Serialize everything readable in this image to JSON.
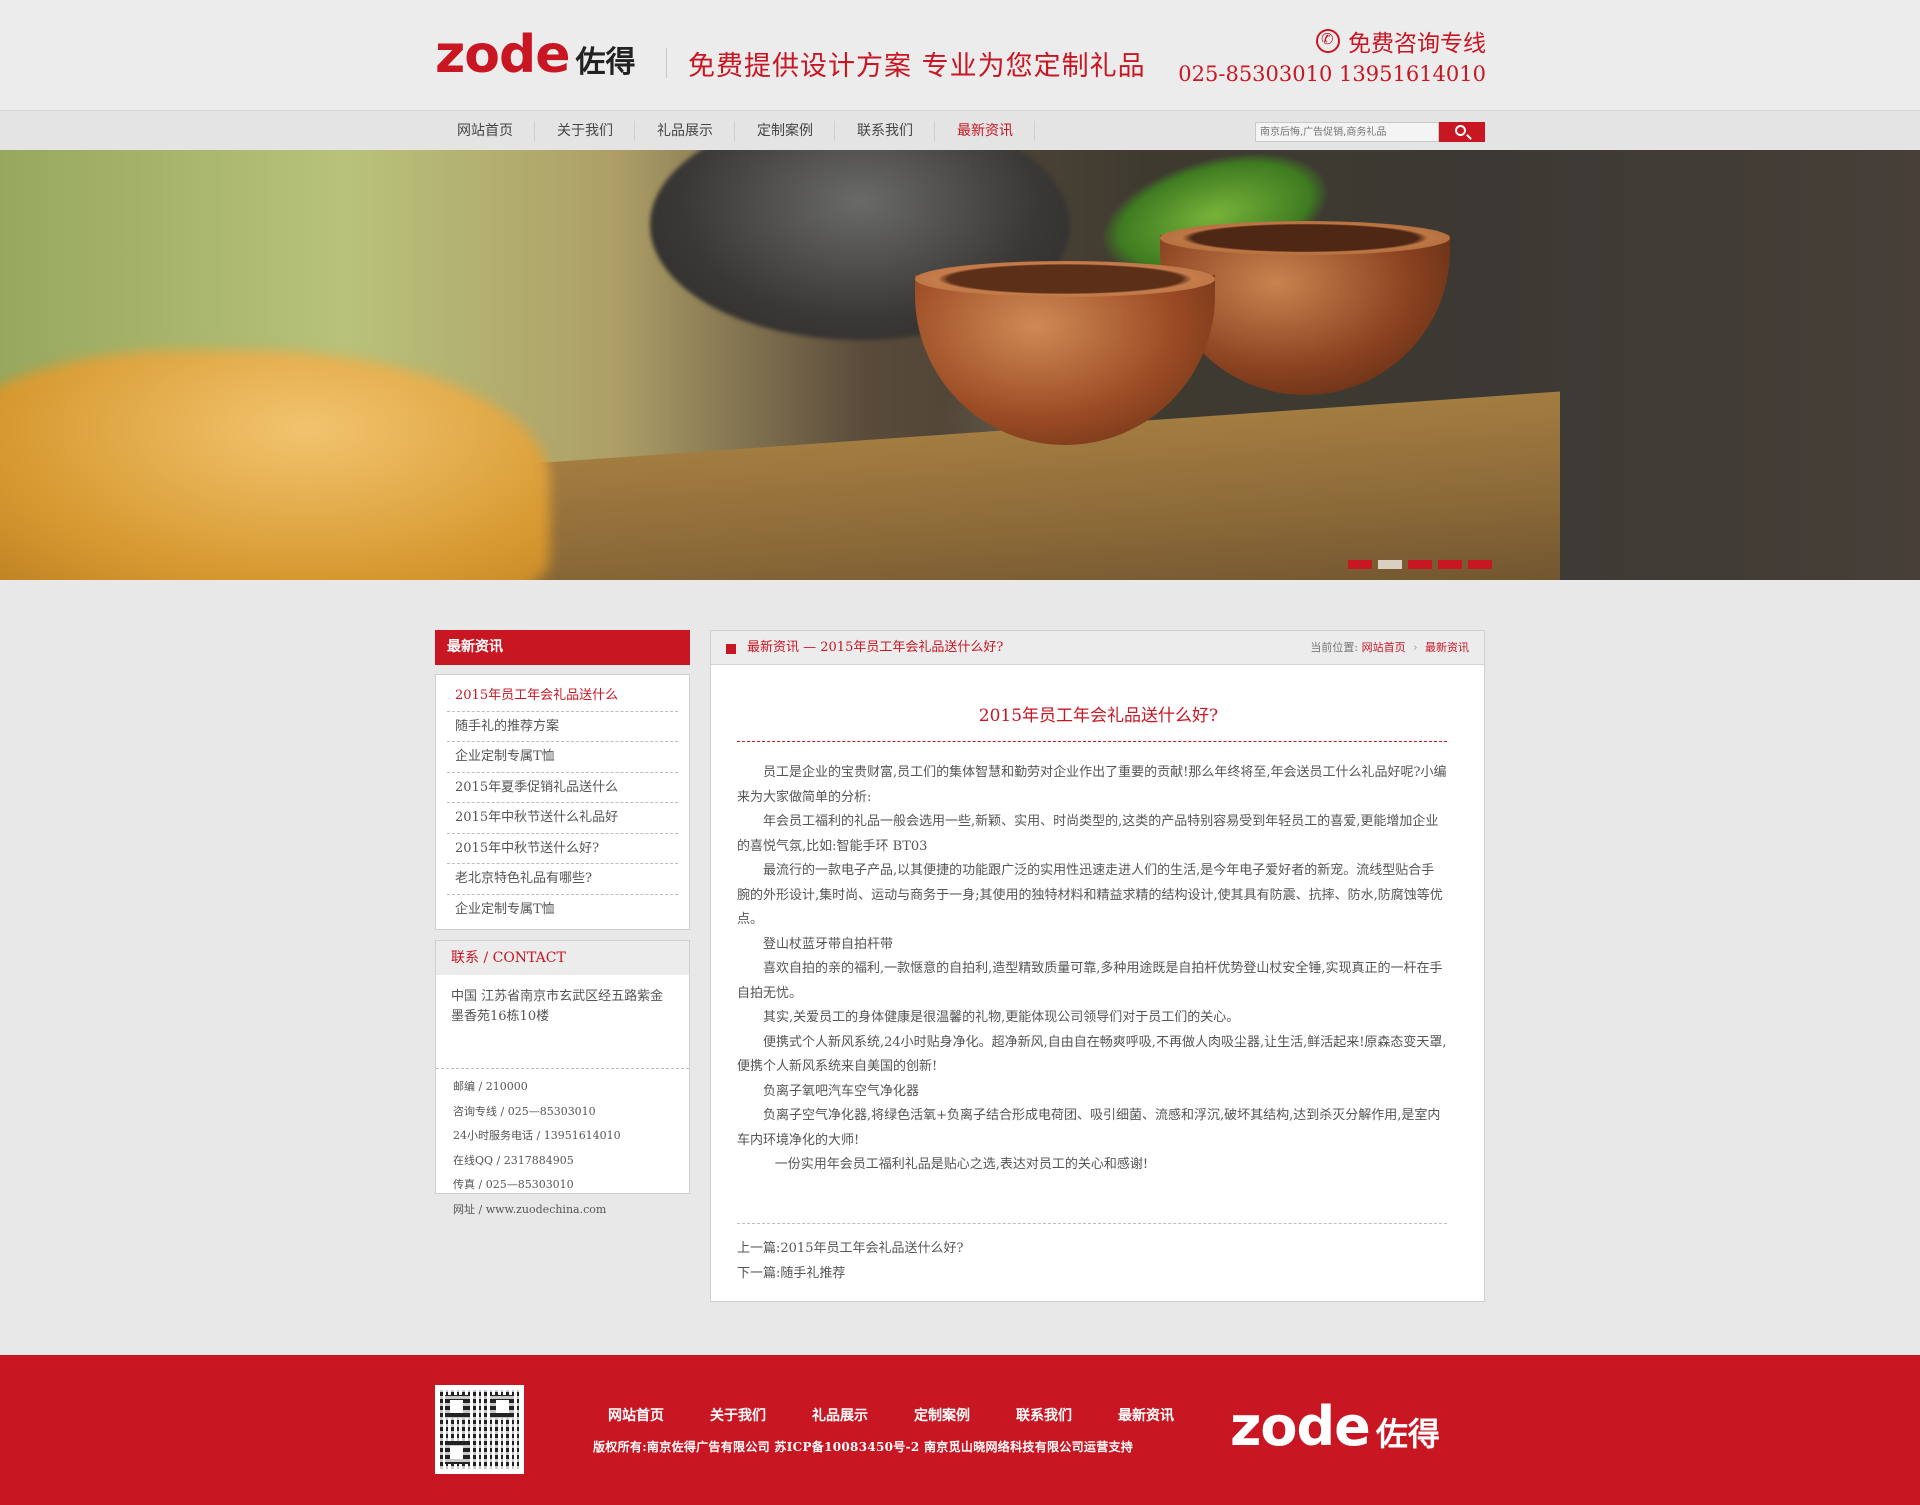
{
  "header": {
    "logo_en": "zode",
    "logo_cn": "佐得",
    "slogan": "免费提供设计方案  专业为您定制礼品",
    "hotline_label": "免费咨询专线",
    "hotline_numbers": "025-85303010  13951614010"
  },
  "nav": {
    "items": [
      {
        "label": "网站首页"
      },
      {
        "label": "关于我们"
      },
      {
        "label": "礼品展示"
      },
      {
        "label": "定制案例"
      },
      {
        "label": "联系我们"
      },
      {
        "label": "最新资讯"
      }
    ],
    "active_index": 5,
    "search_placeholder": "南京后悔,广告促销,商务礼品"
  },
  "banner": {
    "slide_count": 5,
    "active_slide": 1
  },
  "sidebar": {
    "title": "最新资讯",
    "items": [
      {
        "label": "2015年员工年会礼品送什么"
      },
      {
        "label": "随手礼的推荐方案"
      },
      {
        "label": "企业定制专属T恤"
      },
      {
        "label": "2015年夏季促销礼品送什么"
      },
      {
        "label": "2015年中秋节送什么礼品好"
      },
      {
        "label": "2015年中秋节送什么好?"
      },
      {
        "label": "老北京特色礼品有哪些?"
      },
      {
        "label": "企业定制专属T恤"
      }
    ],
    "active_index": 0
  },
  "contact": {
    "title": "联系 / CONTACT",
    "address": "中国 江苏省南京市玄武区经五路紫金墨香苑16栋10楼",
    "rows": [
      {
        "text": "邮编 / 210000"
      },
      {
        "text": "咨询专线 / 025—85303010"
      },
      {
        "text": "24小时服务电话 / 13951614010"
      },
      {
        "text": "在线QQ / 2317884905"
      },
      {
        "text": "传真 / 025—85303010"
      },
      {
        "text": "网址 / www.zuodechina.com"
      }
    ]
  },
  "article": {
    "header_title": "最新资讯 — 2015年员工年会礼品送什么好?",
    "breadcrumb_label": "当前位置:",
    "breadcrumb_home": "网站首页",
    "breadcrumb_current": "最新资讯",
    "title": "2015年员工年会礼品送什么好?",
    "paragraphs": [
      {
        "text": "员工是企业的宝贵财富,员工们的集体智慧和勤劳对企业作出了重要的贡献!那么年终将至,年会送员工什么礼品好呢?小编来为大家做简单的分析:"
      },
      {
        "text": "年会员工福利的礼品一般会选用一些,新颖、实用、时尚类型的,这类的产品特别容易受到年轻员工的喜爱,更能增加企业的喜悦气氛,比如:智能手环 BT03"
      },
      {
        "text": "最流行的一款电子产品,以其便捷的功能跟广泛的实用性迅速走进人们的生活,是今年电子爱好者的新宠。流线型贴合手腕的外形设计,集时尚、运动与商务于一身;其使用的独特材料和精益求精的结构设计,使其具有防震、抗摔、防水,防腐蚀等优点。"
      },
      {
        "text": "登山杖蓝牙带自拍杆带"
      },
      {
        "text": "喜欢自拍的亲的福利,一款惬意的自拍利,造型精致质量可靠,多种用途既是自拍杆优势登山杖安全锤,实现真正的一杆在手自拍无忧。"
      },
      {
        "text": "其实,关爱员工的身体健康是很温馨的礼物,更能体现公司领导们对于员工们的关心。"
      },
      {
        "text": "便携式个人新风系统,24小时贴身净化。超净新风,自由自在畅爽呼吸,不再做人肉吸尘器,让生活,鲜活起来!原森态变天罩,便携个人新风系统来自美国的创新!"
      },
      {
        "text": "负离子氧吧汽车空气净化器"
      },
      {
        "text": "负离子空气净化器,将绿色活氧+负离子结合形成电荷团、吸引细菌、流感和浮沉,破坏其结构,达到杀灭分解作用,是室内车内环境净化的大师!"
      }
    ],
    "closing": "一份实用年会员工福利礼品是贴心之选,表达对员工的关心和感谢!",
    "prev": "上一篇:2015年员工年会礼品送什么好?",
    "next": "下一篇:随手礼推荐"
  },
  "footer": {
    "nav": [
      {
        "label": "网站首页"
      },
      {
        "label": "关于我们"
      },
      {
        "label": "礼品展示"
      },
      {
        "label": "定制案例"
      },
      {
        "label": "联系我们"
      },
      {
        "label": "最新资讯"
      }
    ],
    "copyright": "版权所有:南京佐得广告有限公司 苏ICP备10083450号-2  南京觅山晓网络科技有限公司运营支持",
    "logo_en": "zode",
    "logo_cn": "佐得"
  },
  "colors": {
    "brand_red": "#c81623",
    "page_bg": "#e8e8e8"
  }
}
